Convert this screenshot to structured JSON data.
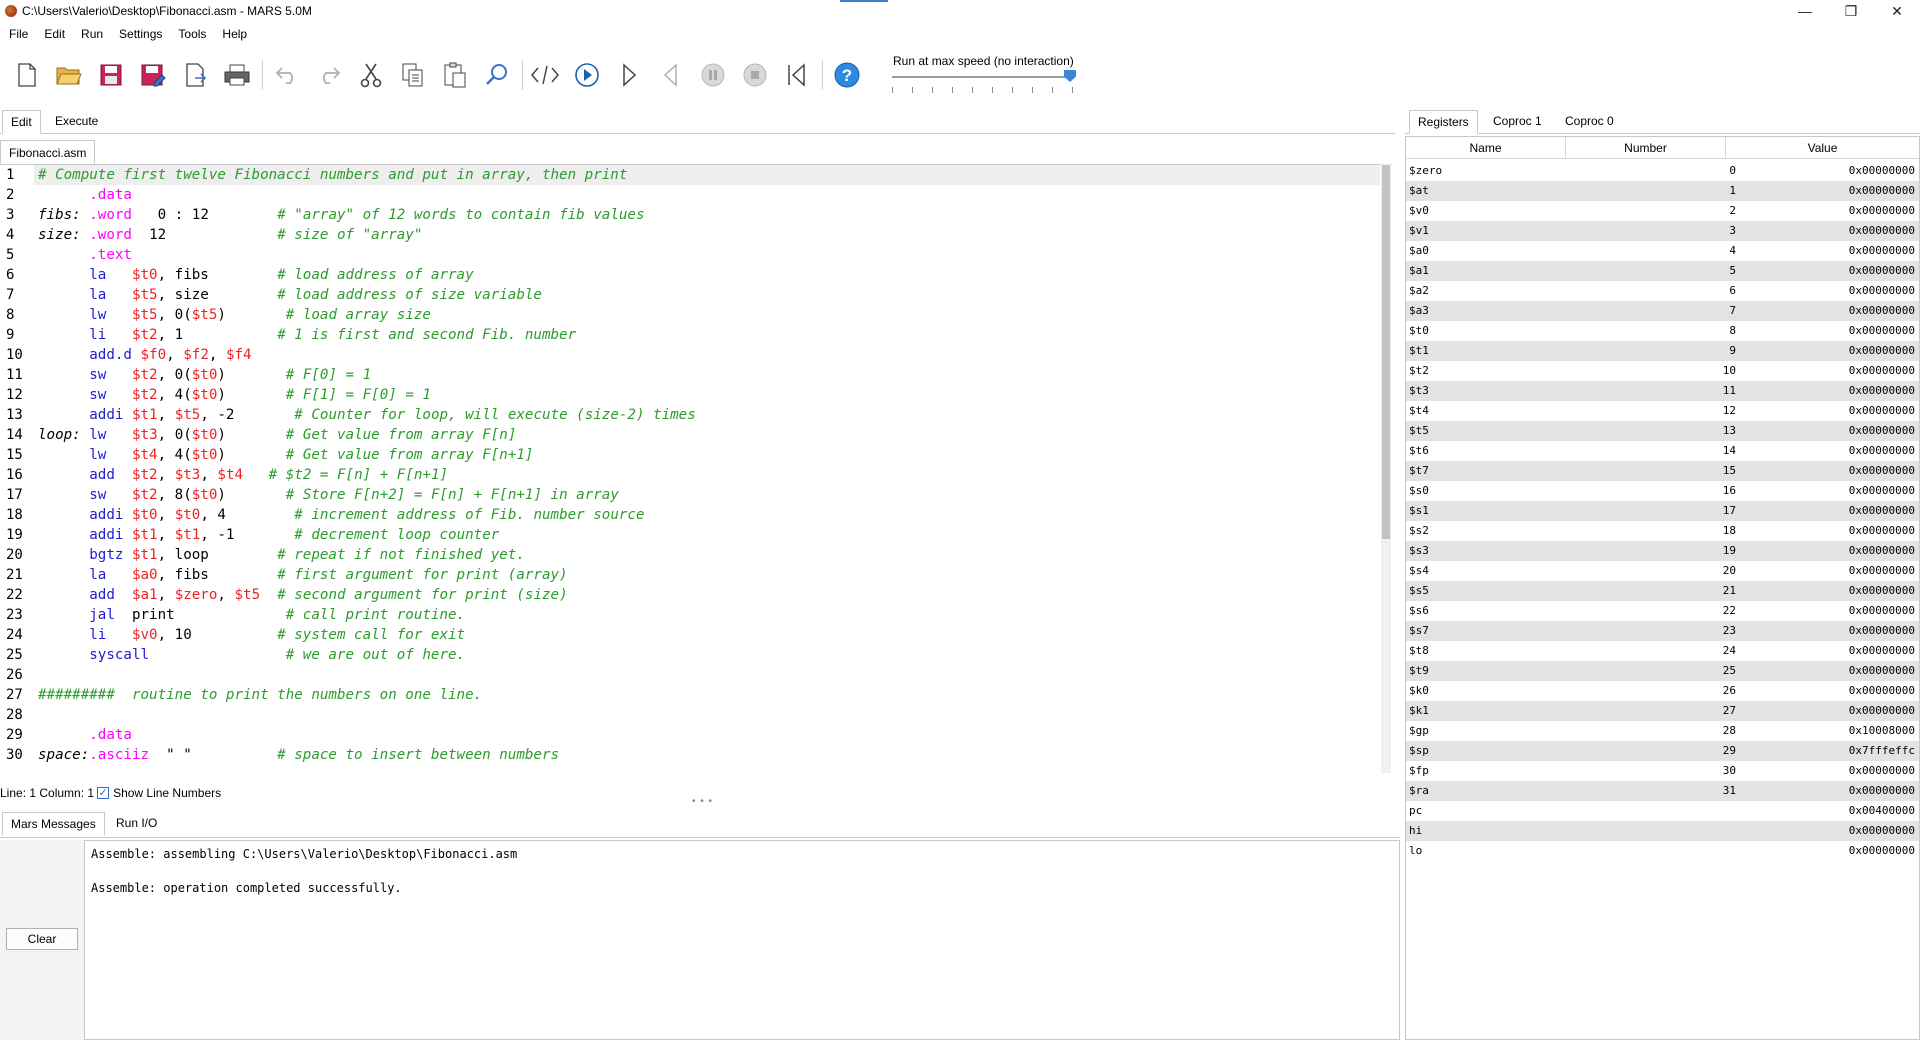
{
  "window": {
    "title": "C:\\Users\\Valerio\\Desktop\\Fibonacci.asm  - MARS 5.0M",
    "minimize": "—",
    "restore": "❐",
    "close": "✕"
  },
  "menu": [
    "File",
    "Edit",
    "Run",
    "Settings",
    "Tools",
    "Help"
  ],
  "toolbar": {
    "speed_label": "Run at max speed (no interaction)",
    "speed_fraction": 1.0,
    "buttons": [
      "new-file-icon",
      "open-icon",
      "save-icon",
      "save-as-icon",
      "dump-icon",
      "print-icon",
      "undo-icon",
      "redo-icon",
      "cut-icon",
      "copy-icon",
      "paste-icon",
      "find-replace-icon",
      "assemble-icon",
      "run-icon",
      "step-icon",
      "backstep-icon",
      "pause-icon",
      "stop-icon",
      "reset-icon",
      "help-icon"
    ]
  },
  "left_tabs": [
    "Edit",
    "Execute"
  ],
  "file_tab": "Fibonacci.asm",
  "editor": {
    "lines": [
      [
        [
          "cmt",
          "# Compute first twelve Fibonacci numbers and put in array, then print"
        ]
      ],
      [
        [
          "plain",
          "      "
        ],
        [
          "dir",
          ".data"
        ]
      ],
      [
        [
          "lbl",
          "fibs:"
        ],
        [
          "plain",
          " "
        ],
        [
          "dir",
          ".word"
        ],
        [
          "plain",
          "   0 : 12        "
        ],
        [
          "cmt",
          "# \"array\" of 12 words to contain fib values"
        ]
      ],
      [
        [
          "lbl",
          "size:"
        ],
        [
          "plain",
          " "
        ],
        [
          "dir",
          ".word"
        ],
        [
          "plain",
          "  12             "
        ],
        [
          "cmt",
          "# size of \"array\""
        ]
      ],
      [
        [
          "plain",
          "      "
        ],
        [
          "dir",
          ".text"
        ]
      ],
      [
        [
          "plain",
          "      "
        ],
        [
          "ins",
          "la"
        ],
        [
          "plain",
          "   "
        ],
        [
          "reg",
          "$t0"
        ],
        [
          "plain",
          ", fibs        "
        ],
        [
          "cmt",
          "# load address of array"
        ]
      ],
      [
        [
          "plain",
          "      "
        ],
        [
          "ins",
          "la"
        ],
        [
          "plain",
          "   "
        ],
        [
          "reg",
          "$t5"
        ],
        [
          "plain",
          ", size        "
        ],
        [
          "cmt",
          "# load address of size variable"
        ]
      ],
      [
        [
          "plain",
          "      "
        ],
        [
          "ins",
          "lw"
        ],
        [
          "plain",
          "   "
        ],
        [
          "reg",
          "$t5"
        ],
        [
          "plain",
          ", 0("
        ],
        [
          "reg",
          "$t5"
        ],
        [
          "plain",
          ")       "
        ],
        [
          "cmt",
          "# load array size"
        ]
      ],
      [
        [
          "plain",
          "      "
        ],
        [
          "ins",
          "li"
        ],
        [
          "plain",
          "   "
        ],
        [
          "reg",
          "$t2"
        ],
        [
          "plain",
          ", 1           "
        ],
        [
          "cmt",
          "# 1 is first and second Fib. number"
        ]
      ],
      [
        [
          "plain",
          "      "
        ],
        [
          "ins",
          "add.d"
        ],
        [
          "plain",
          " "
        ],
        [
          "reg",
          "$f0"
        ],
        [
          "plain",
          ", "
        ],
        [
          "reg",
          "$f2"
        ],
        [
          "plain",
          ", "
        ],
        [
          "reg",
          "$f4"
        ]
      ],
      [
        [
          "plain",
          "      "
        ],
        [
          "ins",
          "sw"
        ],
        [
          "plain",
          "   "
        ],
        [
          "reg",
          "$t2"
        ],
        [
          "plain",
          ", 0("
        ],
        [
          "reg",
          "$t0"
        ],
        [
          "plain",
          ")       "
        ],
        [
          "cmt",
          "# F[0] = 1"
        ]
      ],
      [
        [
          "plain",
          "      "
        ],
        [
          "ins",
          "sw"
        ],
        [
          "plain",
          "   "
        ],
        [
          "reg",
          "$t2"
        ],
        [
          "plain",
          ", 4("
        ],
        [
          "reg",
          "$t0"
        ],
        [
          "plain",
          ")       "
        ],
        [
          "cmt",
          "# F[1] = F[0] = 1"
        ]
      ],
      [
        [
          "plain",
          "      "
        ],
        [
          "ins",
          "addi"
        ],
        [
          "plain",
          " "
        ],
        [
          "reg",
          "$t1"
        ],
        [
          "plain",
          ", "
        ],
        [
          "reg",
          "$t5"
        ],
        [
          "plain",
          ", -2       "
        ],
        [
          "cmt",
          "# Counter for loop, will execute (size-2) times"
        ]
      ],
      [
        [
          "lbl",
          "loop:"
        ],
        [
          "plain",
          " "
        ],
        [
          "ins",
          "lw"
        ],
        [
          "plain",
          "   "
        ],
        [
          "reg",
          "$t3"
        ],
        [
          "plain",
          ", 0("
        ],
        [
          "reg",
          "$t0"
        ],
        [
          "plain",
          ")       "
        ],
        [
          "cmt",
          "# Get value from array F[n]"
        ]
      ],
      [
        [
          "plain",
          "      "
        ],
        [
          "ins",
          "lw"
        ],
        [
          "plain",
          "   "
        ],
        [
          "reg",
          "$t4"
        ],
        [
          "plain",
          ", 4("
        ],
        [
          "reg",
          "$t0"
        ],
        [
          "plain",
          ")       "
        ],
        [
          "cmt",
          "# Get value from array F[n+1]"
        ]
      ],
      [
        [
          "plain",
          "      "
        ],
        [
          "ins",
          "add"
        ],
        [
          "plain",
          "  "
        ],
        [
          "reg",
          "$t2"
        ],
        [
          "plain",
          ", "
        ],
        [
          "reg",
          "$t3"
        ],
        [
          "plain",
          ", "
        ],
        [
          "reg",
          "$t4"
        ],
        [
          "plain",
          "   "
        ],
        [
          "cmt",
          "# $t2 = F[n] + F[n+1]"
        ]
      ],
      [
        [
          "plain",
          "      "
        ],
        [
          "ins",
          "sw"
        ],
        [
          "plain",
          "   "
        ],
        [
          "reg",
          "$t2"
        ],
        [
          "plain",
          ", 8("
        ],
        [
          "reg",
          "$t0"
        ],
        [
          "plain",
          ")       "
        ],
        [
          "cmt",
          "# Store F[n+2] = F[n] + F[n+1] in array"
        ]
      ],
      [
        [
          "plain",
          "      "
        ],
        [
          "ins",
          "addi"
        ],
        [
          "plain",
          " "
        ],
        [
          "reg",
          "$t0"
        ],
        [
          "plain",
          ", "
        ],
        [
          "reg",
          "$t0"
        ],
        [
          "plain",
          ", 4        "
        ],
        [
          "cmt",
          "# increment address of Fib. number source"
        ]
      ],
      [
        [
          "plain",
          "      "
        ],
        [
          "ins",
          "addi"
        ],
        [
          "plain",
          " "
        ],
        [
          "reg",
          "$t1"
        ],
        [
          "plain",
          ", "
        ],
        [
          "reg",
          "$t1"
        ],
        [
          "plain",
          ", -1       "
        ],
        [
          "cmt",
          "# decrement loop counter"
        ]
      ],
      [
        [
          "plain",
          "      "
        ],
        [
          "ins",
          "bgtz"
        ],
        [
          "plain",
          " "
        ],
        [
          "reg",
          "$t1"
        ],
        [
          "plain",
          ", loop        "
        ],
        [
          "cmt",
          "# repeat if not finished yet."
        ]
      ],
      [
        [
          "plain",
          "      "
        ],
        [
          "ins",
          "la"
        ],
        [
          "plain",
          "   "
        ],
        [
          "reg",
          "$a0"
        ],
        [
          "plain",
          ", fibs        "
        ],
        [
          "cmt",
          "# first argument for print (array)"
        ]
      ],
      [
        [
          "plain",
          "      "
        ],
        [
          "ins",
          "add"
        ],
        [
          "plain",
          "  "
        ],
        [
          "reg",
          "$a1"
        ],
        [
          "plain",
          ", "
        ],
        [
          "reg",
          "$zero"
        ],
        [
          "plain",
          ", "
        ],
        [
          "reg",
          "$t5"
        ],
        [
          "plain",
          "  "
        ],
        [
          "cmt",
          "# second argument for print (size)"
        ]
      ],
      [
        [
          "plain",
          "      "
        ],
        [
          "ins",
          "jal"
        ],
        [
          "plain",
          "  print             "
        ],
        [
          "cmt",
          "# call print routine."
        ]
      ],
      [
        [
          "plain",
          "      "
        ],
        [
          "ins",
          "li"
        ],
        [
          "plain",
          "   "
        ],
        [
          "reg",
          "$v0"
        ],
        [
          "plain",
          ", 10          "
        ],
        [
          "cmt",
          "# system call for exit"
        ]
      ],
      [
        [
          "plain",
          "      "
        ],
        [
          "ins",
          "syscall"
        ],
        [
          "plain",
          "                "
        ],
        [
          "cmt",
          "# we are out of here."
        ]
      ],
      [
        [
          "plain",
          ""
        ]
      ],
      [
        [
          "cmt",
          "#########  routine to print the numbers on one line."
        ]
      ],
      [
        [
          "plain",
          ""
        ]
      ],
      [
        [
          "plain",
          "      "
        ],
        [
          "dir",
          ".data"
        ]
      ],
      [
        [
          "lbl",
          "space:"
        ],
        [
          "dir",
          ".asciiz"
        ],
        [
          "plain",
          "  \" \"          "
        ],
        [
          "cmt",
          "# space to insert between numbers"
        ]
      ]
    ]
  },
  "status": {
    "position": "Line: 1 Column: 1",
    "show_line_numbers_label": "Show Line Numbers",
    "show_line_numbers_checked": true
  },
  "message_tabs": [
    "Mars Messages",
    "Run I/O"
  ],
  "messages": [
    "Assemble: assembling C:\\Users\\Valerio\\Desktop\\Fibonacci.asm",
    "Assemble: operation completed successfully."
  ],
  "clear_label": "Clear",
  "reg_tabs": [
    "Registers",
    "Coproc 1",
    "Coproc 0"
  ],
  "reg_headers": [
    "Name",
    "Number",
    "Value"
  ],
  "registers": [
    [
      "$zero",
      "0",
      "0x00000000"
    ],
    [
      "$at",
      "1",
      "0x00000000"
    ],
    [
      "$v0",
      "2",
      "0x00000000"
    ],
    [
      "$v1",
      "3",
      "0x00000000"
    ],
    [
      "$a0",
      "4",
      "0x00000000"
    ],
    [
      "$a1",
      "5",
      "0x00000000"
    ],
    [
      "$a2",
      "6",
      "0x00000000"
    ],
    [
      "$a3",
      "7",
      "0x00000000"
    ],
    [
      "$t0",
      "8",
      "0x00000000"
    ],
    [
      "$t1",
      "9",
      "0x00000000"
    ],
    [
      "$t2",
      "10",
      "0x00000000"
    ],
    [
      "$t3",
      "11",
      "0x00000000"
    ],
    [
      "$t4",
      "12",
      "0x00000000"
    ],
    [
      "$t5",
      "13",
      "0x00000000"
    ],
    [
      "$t6",
      "14",
      "0x00000000"
    ],
    [
      "$t7",
      "15",
      "0x00000000"
    ],
    [
      "$s0",
      "16",
      "0x00000000"
    ],
    [
      "$s1",
      "17",
      "0x00000000"
    ],
    [
      "$s2",
      "18",
      "0x00000000"
    ],
    [
      "$s3",
      "19",
      "0x00000000"
    ],
    [
      "$s4",
      "20",
      "0x00000000"
    ],
    [
      "$s5",
      "21",
      "0x00000000"
    ],
    [
      "$s6",
      "22",
      "0x00000000"
    ],
    [
      "$s7",
      "23",
      "0x00000000"
    ],
    [
      "$t8",
      "24",
      "0x00000000"
    ],
    [
      "$t9",
      "25",
      "0x00000000"
    ],
    [
      "$k0",
      "26",
      "0x00000000"
    ],
    [
      "$k1",
      "27",
      "0x00000000"
    ],
    [
      "$gp",
      "28",
      "0x10008000"
    ],
    [
      "$sp",
      "29",
      "0x7fffeffc"
    ],
    [
      "$fp",
      "30",
      "0x00000000"
    ],
    [
      "$ra",
      "31",
      "0x00000000"
    ],
    [
      "pc",
      "",
      "0x00400000"
    ],
    [
      "hi",
      "",
      "0x00000000"
    ],
    [
      "lo",
      "",
      "0x00000000"
    ]
  ],
  "colors": {
    "comment": "#2c9c2c",
    "directive": "#ff00ff",
    "instruction": "#1c1cd4",
    "register": "#ee2222",
    "accent": "#3c86d6"
  }
}
